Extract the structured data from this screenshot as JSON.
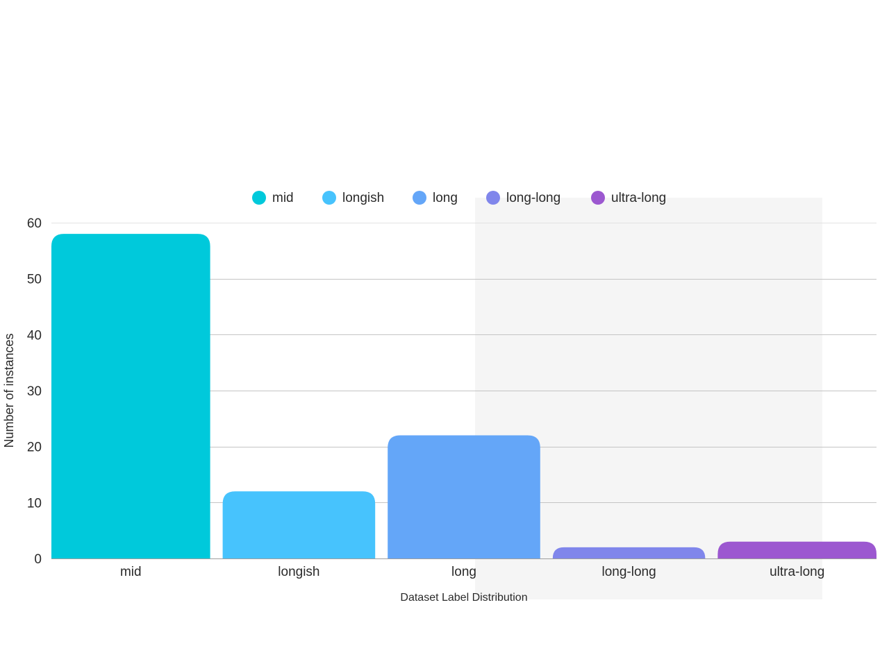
{
  "chart_data": {
    "type": "bar",
    "categories": [
      "mid",
      "longish",
      "long",
      "long-long",
      "ultra-long"
    ],
    "values": [
      58,
      12,
      22,
      2,
      3
    ],
    "colors": [
      "#00c9db",
      "#47c3fd",
      "#64a6f8",
      "#8086eb",
      "#9c58d0"
    ],
    "legend": [
      "mid",
      "longish",
      "long",
      "long-long",
      "ultra-long"
    ],
    "legend_position": "top",
    "xlabel": "Dataset Label Distribution",
    "ylabel": "Number of instances",
    "ylim": [
      0,
      60
    ],
    "yticks": [
      0,
      10,
      20,
      30,
      40,
      50,
      60
    ],
    "grid": true
  }
}
